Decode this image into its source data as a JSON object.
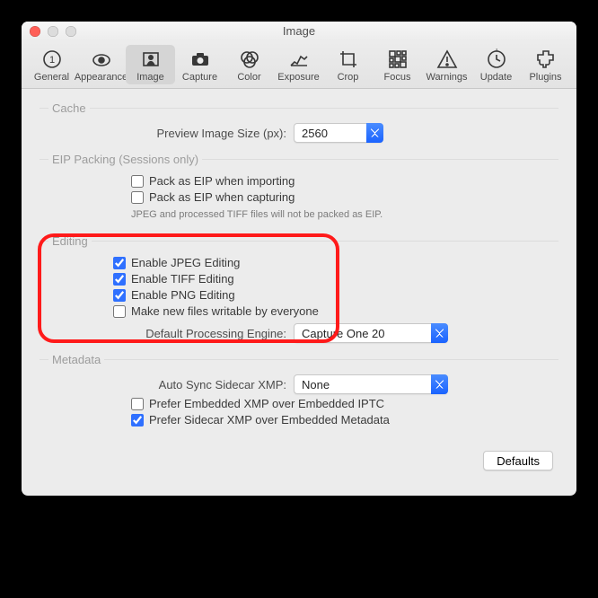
{
  "window": {
    "title": "Image"
  },
  "toolbar": {
    "items": [
      "General",
      "Appearance",
      "Image",
      "Capture",
      "Color",
      "Exposure",
      "Crop",
      "Focus",
      "Warnings",
      "Update",
      "Plugins"
    ],
    "activeIndex": 2
  },
  "cache": {
    "legend": "Cache",
    "preview_label": "Preview Image Size (px):",
    "preview_value": "2560"
  },
  "eip": {
    "legend": "EIP Packing (Sessions only)",
    "importing": {
      "checked": false,
      "label": "Pack as EIP when importing"
    },
    "capturing": {
      "checked": false,
      "label": "Pack as EIP when capturing"
    },
    "note": "JPEG and processed TIFF files will not be packed as EIP."
  },
  "editing": {
    "legend": "Editing",
    "jpeg": {
      "checked": true,
      "label": "Enable JPEG Editing"
    },
    "tiff": {
      "checked": true,
      "label": "Enable TIFF Editing"
    },
    "png": {
      "checked": true,
      "label": "Enable PNG Editing"
    },
    "writable": {
      "checked": false,
      "label": "Make new files writable by everyone"
    },
    "engine_label": "Default Processing Engine:",
    "engine_value": "Capture One 20"
  },
  "metadata": {
    "legend": "Metadata",
    "sync_label": "Auto Sync Sidecar XMP:",
    "sync_value": "None",
    "embedded": {
      "checked": false,
      "label": "Prefer Embedded XMP over Embedded IPTC"
    },
    "sidecar": {
      "checked": true,
      "label": "Prefer Sidecar XMP over Embedded Metadata"
    }
  },
  "footer": {
    "defaults": "Defaults"
  }
}
